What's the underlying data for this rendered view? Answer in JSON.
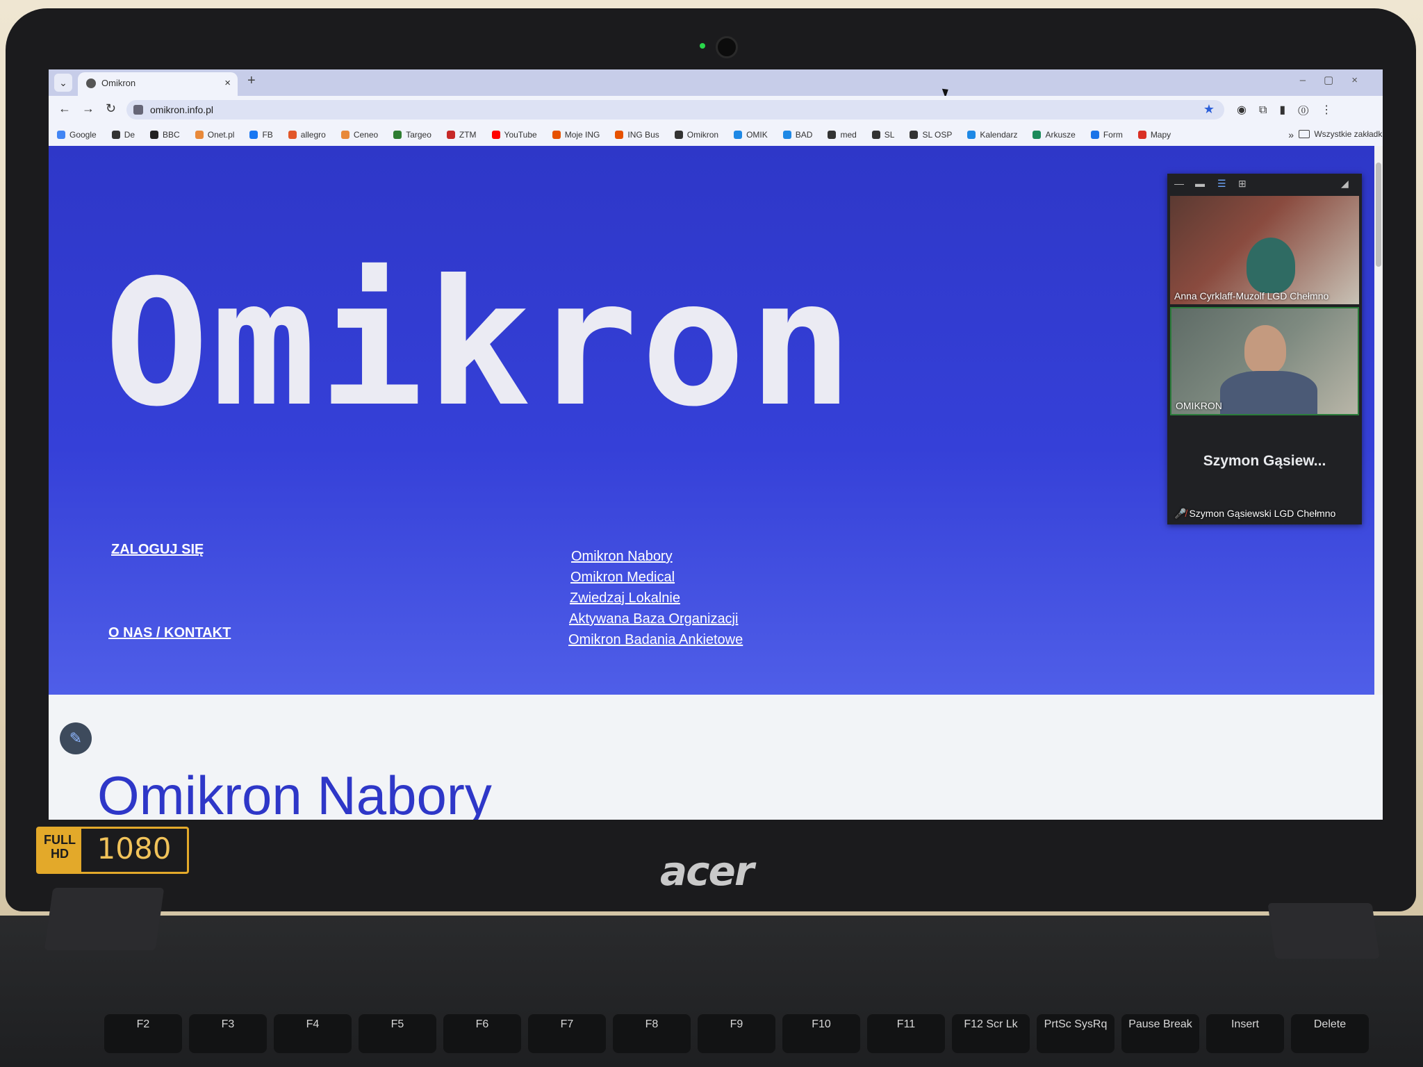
{
  "browser": {
    "tab_title": "Omikron",
    "url": "omikron.info.pl",
    "bookmarks": [
      "Google",
      "De",
      "BBC",
      "Onet.pl",
      "FB",
      "allegro",
      "Ceneo",
      "Targeo",
      "ZTM",
      "YouTube",
      "Moje ING",
      "ING Bus",
      "Omikron",
      "OMIK",
      "BAD",
      "med",
      "SL",
      "SL OSP",
      "Kalendarz",
      "Arkusze",
      "Form",
      "Mapy"
    ],
    "bookmark_colors": [
      "#4285f4",
      "#333333",
      "#222222",
      "#e8893a",
      "#1877f2",
      "#e2572a",
      "#e8893a",
      "#2e7d32",
      "#c62828",
      "#ff0000",
      "#e65100",
      "#e65100",
      "#333333",
      "#1e88e5",
      "#1e88e5",
      "#333333",
      "#333333",
      "#333333",
      "#1e88e5",
      "#1b8a5a",
      "#1a73e8",
      "#d93025"
    ],
    "all_bookmarks_label": "Wszystkie zakładki",
    "more_label": "»"
  },
  "page": {
    "logo": "Omikron",
    "left_links": [
      "ZALOGUJ SIĘ",
      "O NAS / KONTAKT"
    ],
    "center_links": [
      "Omikron Nabory",
      "Omikron Medical",
      "Zwiedzaj Lokalnie",
      "Aktywana Baza Organizacji",
      "Omikron Badania Ankietowe"
    ],
    "section_title": "Omikron Nabory",
    "hero_color": "#2e37c8"
  },
  "call": {
    "participants": [
      {
        "name": "Anna Cyrklaff-Muzolf LGD Chełmno"
      },
      {
        "name": "OMIKRON"
      },
      {
        "display": "Szymon  Gąsiew...",
        "name": "Szymon Gąsiewski LGD Chełmno",
        "muted": true
      }
    ]
  },
  "device": {
    "brand": "acer",
    "badge_left": "FULL HD",
    "badge_right": "1080",
    "keys": [
      "F2",
      "F3",
      "F4",
      "F5",
      "F6",
      "F7",
      "F8",
      "F9",
      "F10",
      "F11",
      "F12 Scr Lk",
      "PrtSc SysRq",
      "Pause Break",
      "Insert",
      "Delete"
    ]
  }
}
